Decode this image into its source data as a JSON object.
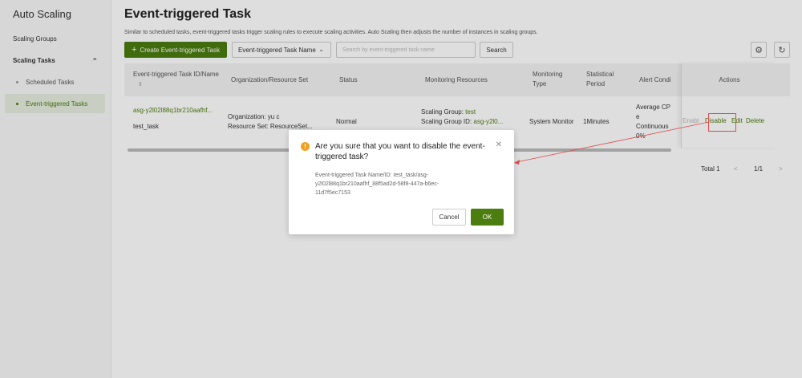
{
  "sidebar": {
    "app_title": "Auto Scaling",
    "items": [
      {
        "label": "Scaling Groups"
      },
      {
        "label": "Scaling Tasks"
      },
      {
        "label": "Scheduled Tasks"
      },
      {
        "label": "Event-triggered Tasks"
      }
    ]
  },
  "header": {
    "title": "Event-triggered Task",
    "description": "Similar to scheduled tasks, event-triggered tasks trigger scaling rules to execute scaling activities. Auto Scaling then adjusts the number of instances in scaling groups."
  },
  "toolbar": {
    "create_label": "Create Event-triggered Task",
    "filter_label": "Event-triggered Task Name",
    "search_placeholder": "Search by event-triggered task name",
    "search_label": "Search"
  },
  "table": {
    "columns": [
      "Event-triggered Task ID/Name",
      "Organization/Resource Set",
      "Status",
      "Monitoring Resources",
      "Monitoring Type",
      "Statistical Period",
      "Alert Condi",
      "Actions"
    ],
    "row": {
      "task_id": "asg-y2l02l88q1br210aafhf...",
      "task_name": "test_task",
      "organization": "Organization: yu c",
      "resource_set": "Resource Set: ResourceSet...",
      "status": "Normal",
      "scaling_group_prefix": "Scaling Group: ",
      "scaling_group": "test",
      "scaling_group_id_prefix": "Scaling Group ID: ",
      "scaling_group_id": "asg-y2l0...",
      "monitoring_type": "System Monitor",
      "statistical_period": "1Minutes",
      "alert_line1": "Average CP",
      "alert_line2": "e",
      "alert_line3": "Continuous",
      "alert_line4": "0%",
      "action_enable": "Enabl",
      "action_disable": "Disable",
      "action_edit": "Edit",
      "action_delete": "Delete"
    }
  },
  "pagination": {
    "total": "Total 1",
    "prev": "<",
    "pages": "1/1",
    "next": ">"
  },
  "dialog": {
    "title": "Are you sure that you want to disable the event-triggered task?",
    "body": "Event-triggered Task Name/ID: test_task/asg-y2l02l88q1br210aafhf_88f5ad2d-58f8-447a-b6ec-11d7f5ec7153",
    "cancel_label": "Cancel",
    "ok_label": "OK"
  },
  "colors": {
    "accent": "#4b7d0f",
    "warning": "#f0a020",
    "annotation": "#e04a4a"
  }
}
